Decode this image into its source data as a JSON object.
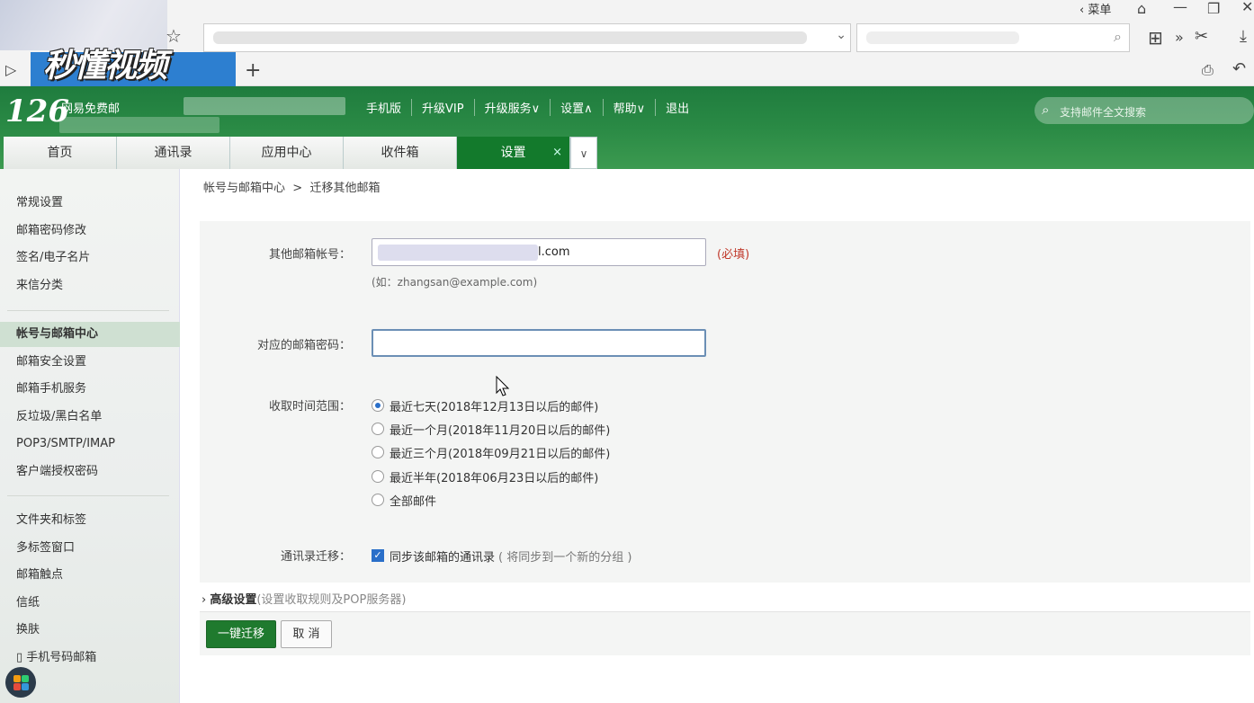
{
  "browser": {
    "watermark": "秒懂视频",
    "menu_label": "菜单",
    "new_tab": "+"
  },
  "header": {
    "logo_number": "126",
    "logo_text": "网易免费邮",
    "nav": [
      "手机版",
      "升级VIP",
      "升级服务∨",
      "设置∧",
      "帮助∨",
      "退出"
    ],
    "search_placeholder": "支持邮件全文搜索"
  },
  "tabs": [
    {
      "label": "首页"
    },
    {
      "label": "通讯录"
    },
    {
      "label": "应用中心"
    },
    {
      "label": "收件箱"
    },
    {
      "label": "设置",
      "active": true
    }
  ],
  "tab_close": "×",
  "tab_more": "∨",
  "sidebar": {
    "group1": [
      "常规设置",
      "邮箱密码修改",
      "签名/电子名片",
      "来信分类"
    ],
    "group2": [
      "帐号与邮箱中心",
      "邮箱安全设置",
      "邮箱手机服务",
      "反垃圾/黑白名单",
      "POP3/SMTP/IMAP",
      "客户端授权密码"
    ],
    "group3": [
      "文件夹和标签",
      "多标签窗口",
      "邮箱触点",
      "信纸",
      "换肤",
      "▯ 手机号码邮箱"
    ]
  },
  "breadcrumb": {
    "parent": "帐号与邮箱中心",
    "separator": ">",
    "current": "迁移其他邮箱"
  },
  "form": {
    "account_label": "其他邮箱帐号：",
    "account_value_suffix": "l.com",
    "required": "(必填)",
    "account_hint": "(如：zhangsan@example.com)",
    "password_label": "对应的邮箱密码：",
    "range_label": "收取时间范围：",
    "ranges": [
      {
        "label": "最近七天(2018年12月13日以后的邮件)",
        "selected": true
      },
      {
        "label": "最近一个月(2018年11月20日以后的邮件)",
        "selected": false
      },
      {
        "label": "最近三个月(2018年09月21日以后的邮件)",
        "selected": false
      },
      {
        "label": "最近半年(2018年06月23日以后的邮件)",
        "selected": false
      },
      {
        "label": "全部邮件",
        "selected": false
      }
    ],
    "contacts_label": "通讯录迁移：",
    "contacts_checkbox": "同步该邮箱的通讯录",
    "contacts_note": "( 将同步到一个新的分组 )",
    "contacts_checked": true
  },
  "advanced": {
    "arrow": "›",
    "title": "高级设置",
    "desc": "(设置收取规则及POP服务器)"
  },
  "buttons": {
    "migrate": "一键迁移",
    "cancel": "取 消"
  },
  "colors": {
    "header_green": "#2a8a45",
    "active_tab": "#137a2c",
    "primary_button": "#1f7a2e",
    "required_red": "#c0392b"
  }
}
